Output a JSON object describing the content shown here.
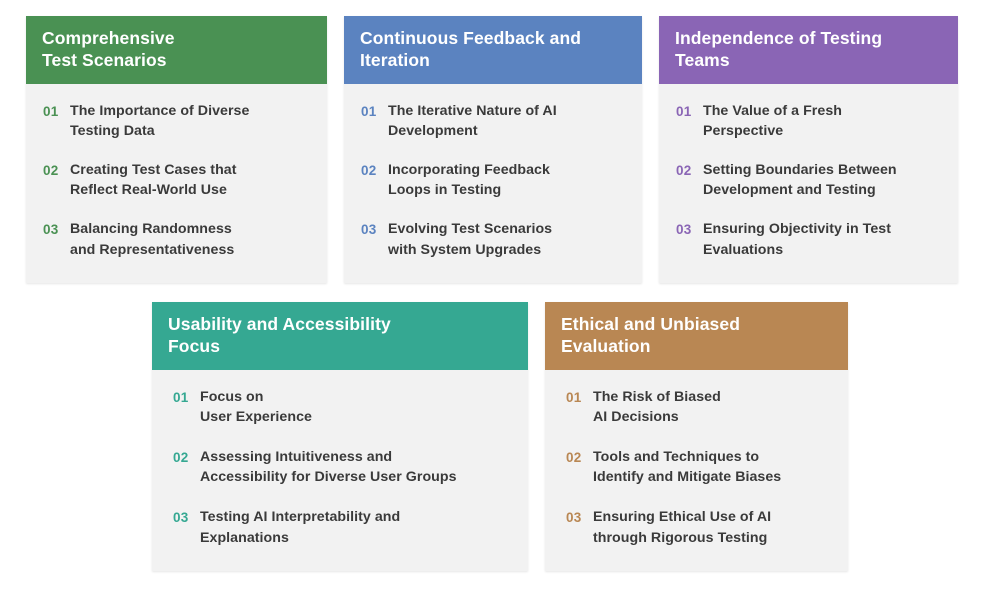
{
  "cards": [
    {
      "title": "Comprehensive\nTest Scenarios",
      "color": "#4a9153",
      "items": [
        {
          "num": "01",
          "text": "The Importance of Diverse\nTesting Data"
        },
        {
          "num": "02",
          "text": "Creating Test Cases that\nReflect Real-World Use"
        },
        {
          "num": "03",
          "text": "Balancing Randomness\nand Representativeness"
        }
      ]
    },
    {
      "title": "Continuous Feedback and\nIteration",
      "color": "#5b83c0",
      "items": [
        {
          "num": "01",
          "text": "The Iterative Nature of AI\nDevelopment"
        },
        {
          "num": "02",
          "text": "Incorporating Feedback\nLoops in Testing"
        },
        {
          "num": "03",
          "text": "Evolving Test Scenarios\nwith System Upgrades"
        }
      ]
    },
    {
      "title": "Independence of Testing\nTeams",
      "color": "#8a65b5",
      "items": [
        {
          "num": "01",
          "text": "The Value of a Fresh\nPerspective"
        },
        {
          "num": "02",
          "text": "Setting Boundaries Between\nDevelopment and Testing"
        },
        {
          "num": "03",
          "text": "Ensuring Objectivity in Test\nEvaluations"
        }
      ]
    },
    {
      "title": "Usability and Accessibility\nFocus",
      "color": "#35a892",
      "items": [
        {
          "num": "01",
          "text": "Focus on\nUser Experience"
        },
        {
          "num": "02",
          "text": "Assessing Intuitiveness and\nAccessibility for Diverse User Groups"
        },
        {
          "num": "03",
          "text": "Testing AI Interpretability and\nExplanations"
        }
      ]
    },
    {
      "title": "Ethical and Unbiased\nEvaluation",
      "color": "#b98753",
      "items": [
        {
          "num": "01",
          "text": "The Risk of Biased\nAI Decisions"
        },
        {
          "num": "02",
          "text": "Tools and Techniques to\nIdentify and Mitigate Biases"
        },
        {
          "num": "03",
          "text": "Ensuring Ethical Use of AI\nthrough Rigorous Testing"
        }
      ]
    }
  ]
}
